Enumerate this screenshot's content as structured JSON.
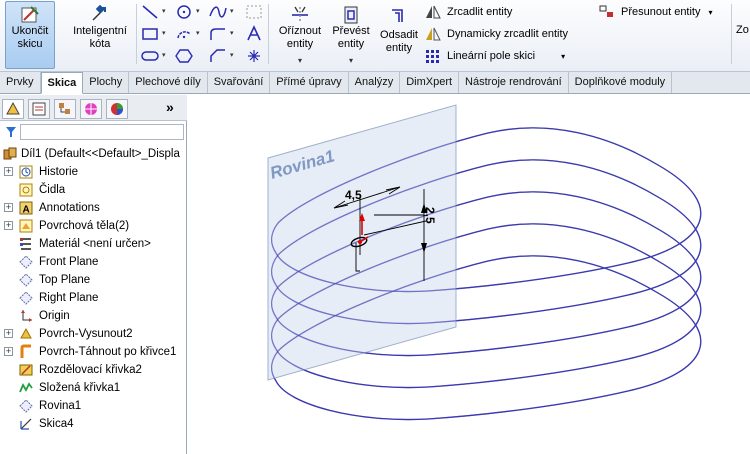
{
  "ribbon": {
    "exit_sketch": "Ukončit skicu",
    "smart_dimension": "Inteligentní kóta",
    "trim": "Oříznout entity",
    "convert": "Převést entity",
    "offset": "Odsadit entity",
    "mirror": "Zrcadlit entity",
    "dynamic_mirror": "Dynamicky zrcadlit entity",
    "linear_pattern": "Lineární pole skici",
    "move": "Přesunout entity",
    "cut_label": "Zo"
  },
  "tabs": [
    "Prvky",
    "Skica",
    "Plochy",
    "Plechové díly",
    "Svařování",
    "Přímé úpravy",
    "Analýzy",
    "DimXpert",
    "Nástroje rendrování",
    "Doplňkové moduly"
  ],
  "active_tab": "Skica",
  "panel": {
    "more": "»"
  },
  "tree": {
    "root": "Díl1  (Default<<Default>_Displa",
    "items": [
      {
        "label": "Historie",
        "icon": "history-icon",
        "expand": true
      },
      {
        "label": "Čidla",
        "icon": "sensor-icon",
        "expand": false
      },
      {
        "label": "Annotations",
        "icon": "annotations-icon",
        "expand": true
      },
      {
        "label": "Povrchová těla(2)",
        "icon": "surface-bodies-icon",
        "expand": true
      },
      {
        "label": "Materiál <není určen>",
        "icon": "material-icon",
        "expand": false
      },
      {
        "label": "Front Plane",
        "icon": "plane-icon",
        "expand": false
      },
      {
        "label": "Top Plane",
        "icon": "plane-icon",
        "expand": false
      },
      {
        "label": "Right Plane",
        "icon": "plane-icon",
        "expand": false
      },
      {
        "label": "Origin",
        "icon": "origin-icon",
        "expand": false
      },
      {
        "label": "Povrch-Vysunout2",
        "icon": "extrude-surface-icon",
        "expand": true
      },
      {
        "label": "Povrch-Táhnout po křivce1",
        "icon": "sweep-surface-icon",
        "expand": true
      },
      {
        "label": "Rozdělovací křivka2",
        "icon": "split-line-icon",
        "expand": false
      },
      {
        "label": "Složená křivka1",
        "icon": "composite-curve-icon",
        "expand": false
      },
      {
        "label": "Rovina1",
        "icon": "plane-icon",
        "expand": false
      },
      {
        "label": "Skica4",
        "icon": "sketch-icon",
        "expand": false
      }
    ]
  },
  "viewport": {
    "plane_label": "Rovina1",
    "dim_horizontal": "4,5",
    "dim_vertical": "2,5"
  },
  "colors": {
    "helix": "#3b3bb0",
    "plane_fill": "#dfe7f3",
    "plane_text": "#7f98c4",
    "accent": "#a9ccf0"
  }
}
